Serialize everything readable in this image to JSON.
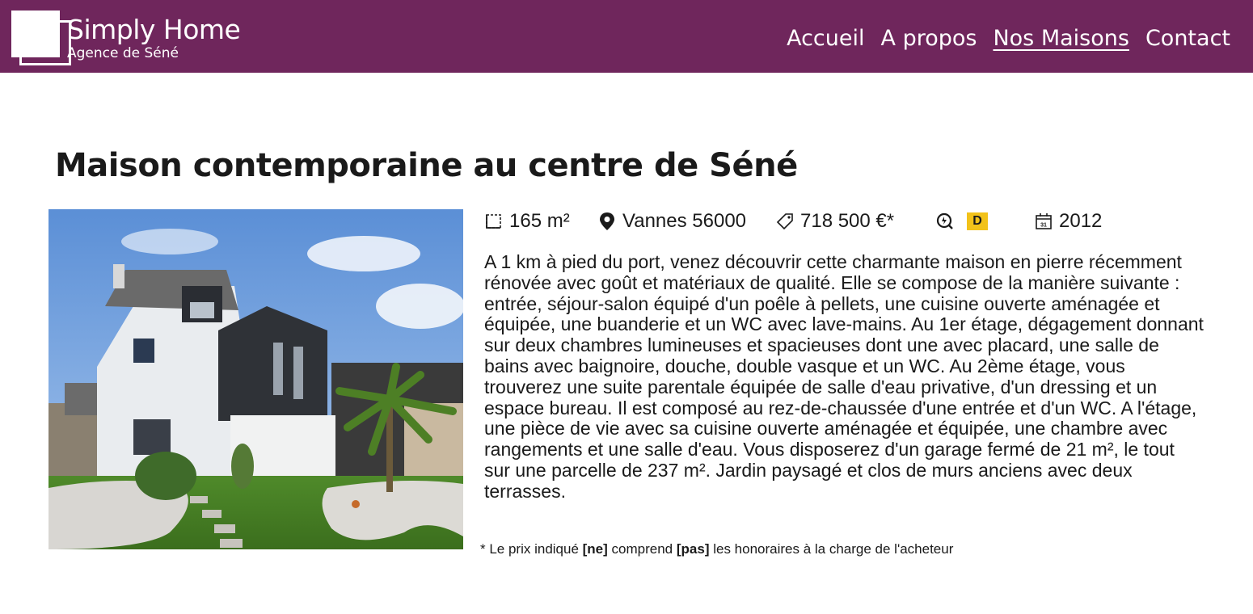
{
  "header": {
    "brand_title": "Simply Home",
    "brand_subtitle": "Agence de Séné",
    "nav": [
      {
        "label": "Accueil",
        "active": false
      },
      {
        "label": "A propos",
        "active": false
      },
      {
        "label": "Nos Maisons",
        "active": true
      },
      {
        "label": "Contact",
        "active": false
      }
    ],
    "background": "#6f265c"
  },
  "listing": {
    "title": "Maison contemporaine au centre de Séné",
    "photo_icon": "house-photo",
    "facts": {
      "surface": "165 m²",
      "location": "Vannes 56000",
      "price": "718 500 €*",
      "energy_class": "D",
      "year": "2012"
    },
    "description": "A 1 km à pied du port, venez découvrir cette charmante maison en pierre récemment rénovée avec goût et matériaux de qualité. Elle se compose de la manière suivante : entrée, séjour-salon équipé d'un poêle à pellets, une cuisine ouverte aménagée et équipée, une buanderie et un WC avec lave-mains. Au 1er étage, dégagement donnant sur deux chambres lumineuses et spacieuses dont une avec placard, une salle de bains avec baignoire, douche, double vasque et un WC. Au 2ème étage, vous trouverez une suite parentale équipée de salle d'eau privative, d'un dressing et un espace bureau. Il est composé au rez-de-chaussée d'une entrée et d'un WC. A l'étage, une pièce de vie avec sa cuisine ouverte aménagée et équipée, une chambre avec rangements et une salle d'eau. Vous disposerez d'un garage fermé de 21 m², le tout sur une parcelle de 237 m². Jardin paysagé et clos de murs anciens avec deux terrasses.",
    "note": {
      "part1": "* Le prix indiqué ",
      "ne": "[ne]",
      "part2": " comprend ",
      "pas": "[pas]",
      "part3": " les honoraires à la charge de l'acheteur"
    }
  },
  "colors": {
    "accent": "#6f265c",
    "energy_badge": "#f2c21a"
  }
}
